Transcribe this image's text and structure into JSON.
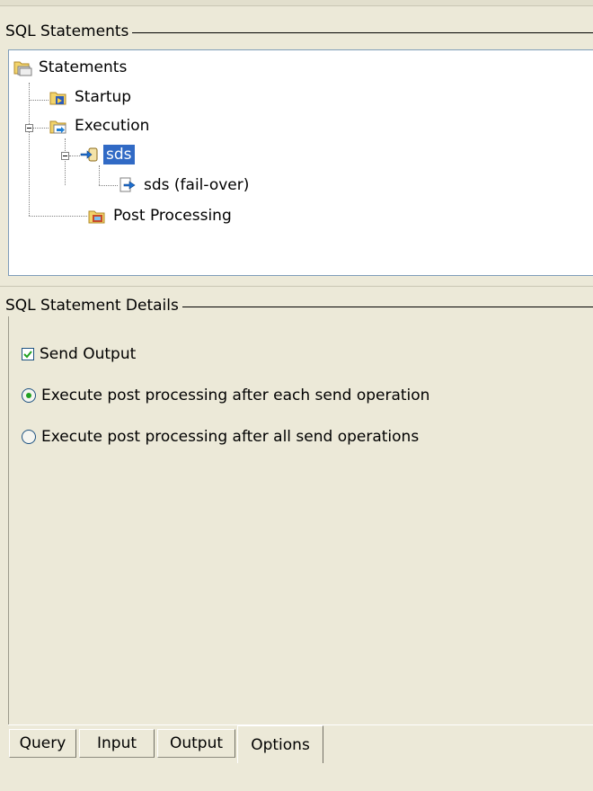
{
  "statements_group": {
    "title": "SQL Statements"
  },
  "tree": {
    "root": {
      "label": "Statements",
      "icon": "folder-stack-icon"
    },
    "startup": {
      "label": "Startup",
      "icon": "startup-folder-icon"
    },
    "execution": {
      "label": "Execution",
      "icon": "execution-folder-icon"
    },
    "sds": {
      "label": "sds",
      "icon": "statement-arrow-icon",
      "selected": true
    },
    "sds_failover": {
      "label": "sds (fail-over)",
      "icon": "document-arrow-icon"
    },
    "post_processing": {
      "label": "Post Processing",
      "icon": "post-processing-folder-icon"
    }
  },
  "details_group": {
    "title": "SQL Statement Details"
  },
  "details": {
    "send_output": {
      "label": "Send Output",
      "checked": true
    },
    "radio_each": {
      "label": "Execute post processing after each send operation",
      "checked": true
    },
    "radio_all": {
      "label": "Execute post processing after all send operations",
      "checked": false
    }
  },
  "tabs": [
    {
      "label": "Query"
    },
    {
      "label": "Input"
    },
    {
      "label": "Output"
    },
    {
      "label": "Options",
      "active": true
    }
  ],
  "colors": {
    "selection": "#316ac5",
    "panel_bg": "#ece9d8",
    "check_green": "#21a121"
  }
}
